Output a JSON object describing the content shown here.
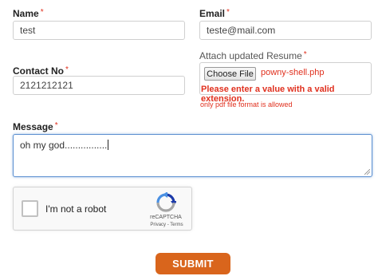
{
  "name": {
    "label": "Name",
    "required_mark": "*",
    "value": "test"
  },
  "email": {
    "label": "Email",
    "required_mark": "*",
    "value": "teste@mail.com"
  },
  "contact": {
    "label": "Contact No",
    "required_mark": "*",
    "value": "2121212121"
  },
  "resume": {
    "label": "Attach updated Resume",
    "required_mark": "*",
    "button_label": "Choose File",
    "file_name": "powny-shell.php",
    "error": "Please enter a value with a valid extension.",
    "hint": "only pdf file format is allowed"
  },
  "message": {
    "label": "Message",
    "required_mark": "*",
    "value": "oh my god................"
  },
  "recaptcha": {
    "label": "I'm not a robot",
    "brand": "reCAPTCHA",
    "links": "Privacy - Terms"
  },
  "submit": {
    "label": "SUBMIT"
  },
  "colors": {
    "accent": "#d9651c",
    "error": "#e0301e",
    "focus": "#5b8fd0"
  }
}
